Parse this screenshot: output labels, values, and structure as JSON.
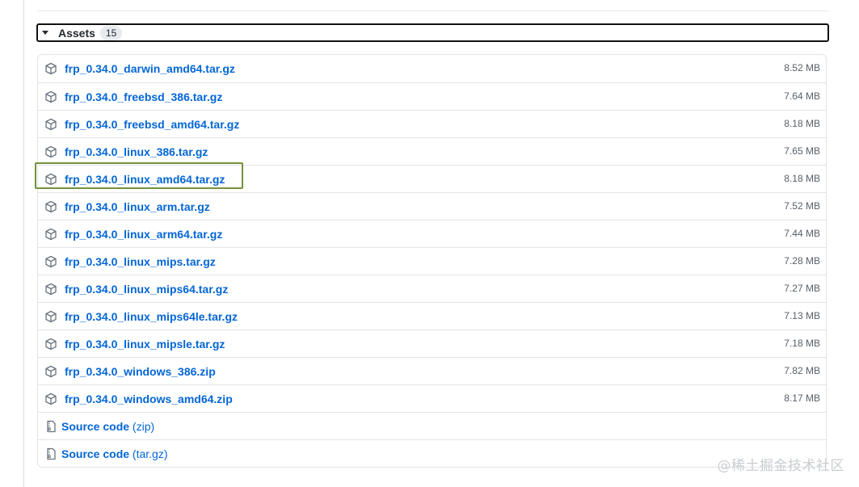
{
  "assets": {
    "title": "Assets",
    "count": "15",
    "files": [
      {
        "name": "frp_0.34.0_darwin_amd64.tar.gz",
        "size": "8.52 MB",
        "icon": "package-icon"
      },
      {
        "name": "frp_0.34.0_freebsd_386.tar.gz",
        "size": "7.64 MB",
        "icon": "package-icon"
      },
      {
        "name": "frp_0.34.0_freebsd_amd64.tar.gz",
        "size": "8.18 MB",
        "icon": "package-icon"
      },
      {
        "name": "frp_0.34.0_linux_386.tar.gz",
        "size": "7.65 MB",
        "icon": "package-icon"
      },
      {
        "name": "frp_0.34.0_linux_amd64.tar.gz",
        "size": "8.18 MB",
        "icon": "package-icon"
      },
      {
        "name": "frp_0.34.0_linux_arm.tar.gz",
        "size": "7.52 MB",
        "icon": "package-icon"
      },
      {
        "name": "frp_0.34.0_linux_arm64.tar.gz",
        "size": "7.44 MB",
        "icon": "package-icon"
      },
      {
        "name": "frp_0.34.0_linux_mips.tar.gz",
        "size": "7.28 MB",
        "icon": "package-icon"
      },
      {
        "name": "frp_0.34.0_linux_mips64.tar.gz",
        "size": "7.27 MB",
        "icon": "package-icon"
      },
      {
        "name": "frp_0.34.0_linux_mips64le.tar.gz",
        "size": "7.13 MB",
        "icon": "package-icon"
      },
      {
        "name": "frp_0.34.0_linux_mipsle.tar.gz",
        "size": "7.18 MB",
        "icon": "package-icon"
      },
      {
        "name": "frp_0.34.0_windows_386.zip",
        "size": "7.82 MB",
        "icon": "package-icon"
      },
      {
        "name": "frp_0.34.0_windows_amd64.zip",
        "size": "8.17 MB",
        "icon": "package-icon"
      }
    ],
    "source_code": [
      {
        "label": "Source code",
        "ext": "(zip)",
        "icon": "file-zip-icon"
      },
      {
        "label": "Source code",
        "ext": "(tar.gz)",
        "icon": "file-zip-icon"
      }
    ]
  },
  "watermark": "@稀土掘金技术社区",
  "colors": {
    "link": "#0366d6",
    "highlight": "#75923c",
    "border": "#e1e4e8",
    "muted": "#586069"
  }
}
